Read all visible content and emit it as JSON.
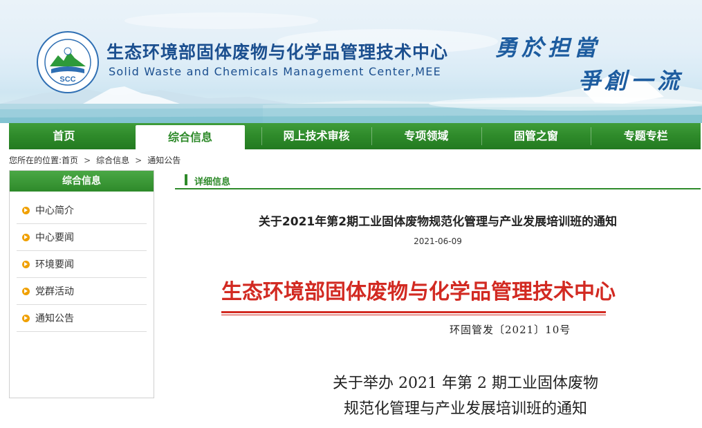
{
  "header": {
    "site_name_cn": "生态环境部固体废物与化学品管理技术中心",
    "site_name_en": "Solid Waste and Chemicals Management Center,MEE",
    "logo_text": "SCC",
    "slogan_line1": "勇於担當",
    "slogan_line2": "爭創一流"
  },
  "nav": {
    "items": [
      {
        "label": "首页",
        "active": false
      },
      {
        "label": "综合信息",
        "active": true
      },
      {
        "label": "网上技术审核",
        "active": false
      },
      {
        "label": "专项领域",
        "active": false
      },
      {
        "label": "固管之窗",
        "active": false
      },
      {
        "label": "专题专栏",
        "active": false
      }
    ]
  },
  "breadcrumb": {
    "prefix": "您所在的位置:",
    "items": [
      "首页",
      "综合信息",
      "通知公告"
    ],
    "separator": ">"
  },
  "sidebar": {
    "title": "综合信息",
    "items": [
      {
        "label": "中心简介"
      },
      {
        "label": "中心要闻"
      },
      {
        "label": "环境要闻"
      },
      {
        "label": "党群活动"
      },
      {
        "label": "通知公告"
      }
    ]
  },
  "main": {
    "section_label": "详细信息",
    "article_title": "关于2021年第2期工业固体废物规范化管理与产业发展培训班的通知",
    "article_date": "2021-06-09",
    "doc_header": "生态环境部固体废物与化学品管理技术中心",
    "doc_number": "环固管发〔2021〕10号",
    "doc_title_line1": "关于举办 2021 年第 2 期工业固体废物",
    "doc_title_line2": "规范化管理与产业发展培训班的通知"
  },
  "colors": {
    "nav_green": "#2e8a2a",
    "title_blue": "#1b4f8f",
    "doc_red": "#d22a22",
    "bullet_orange": "#f0a000"
  }
}
